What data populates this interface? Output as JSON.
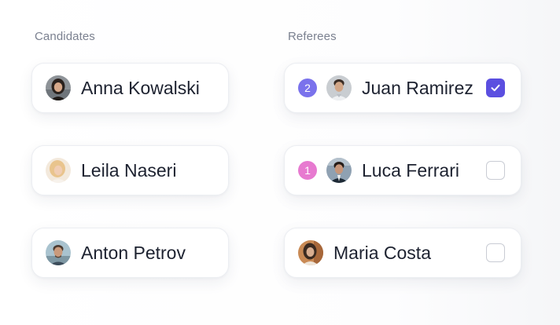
{
  "headings": {
    "candidates": "Candidates",
    "referees": "Referees"
  },
  "colors": {
    "accent": "#5b4fe0",
    "badge_2": "#7a72ec",
    "badge_1": "#e77ad0"
  },
  "candidates": [
    {
      "name": "Anna Kowalski",
      "avatar_icon": "avatar-photo"
    },
    {
      "name": "Leila Naseri",
      "avatar_icon": "avatar-photo"
    },
    {
      "name": "Anton Petrov",
      "avatar_icon": "avatar-photo"
    }
  ],
  "referees": [
    {
      "order": "2",
      "name": "Juan Ramirez",
      "checked": true,
      "avatar_icon": "avatar-photo"
    },
    {
      "order": "1",
      "name": "Luca Ferrari",
      "checked": false,
      "avatar_icon": "avatar-photo"
    },
    {
      "order": "",
      "name": "Maria Costa",
      "checked": false,
      "avatar_icon": "avatar-photo"
    }
  ]
}
